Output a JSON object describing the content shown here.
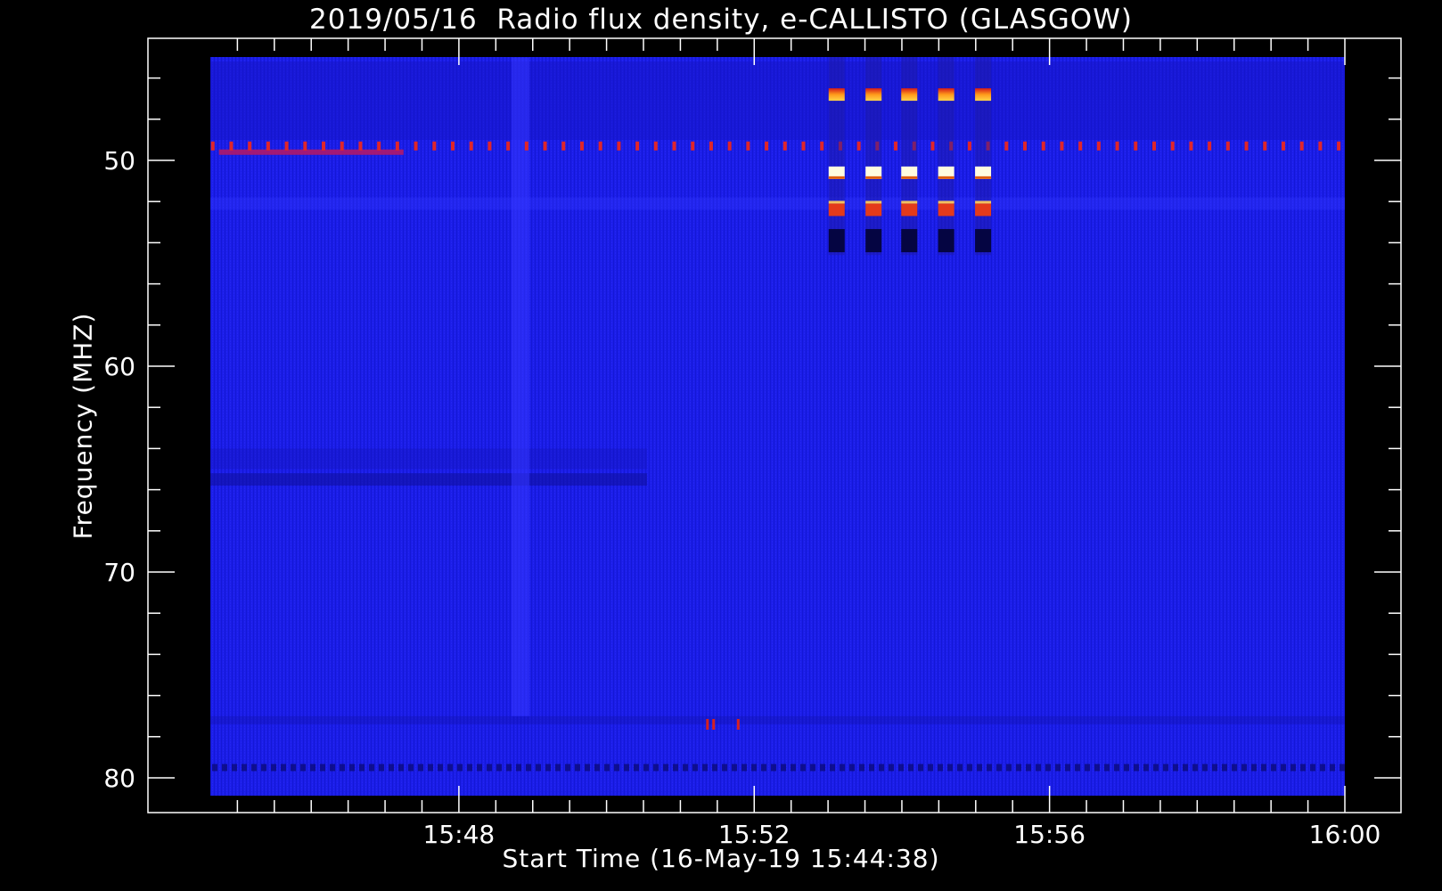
{
  "chart_data": {
    "type": "heatmap",
    "title": "2019/05/16  Radio flux density, e-CALLISTO (GLASGOW)",
    "xlabel": "Start Time (16-May-19 15:44:38)",
    "ylabel": "Frequency (MHZ)",
    "x_ticks": [
      "15:48",
      "15:52",
      "15:56",
      "16:00"
    ],
    "y_ticks": [
      50,
      60,
      70,
      80
    ],
    "xlim": [
      "15:44:38",
      "16:00:00"
    ],
    "ylim": [
      45,
      81
    ],
    "y_inverted": true,
    "colormap": "red-temperature on blue background",
    "colors": {
      "background": "#000000",
      "spectrogram_base": "#1b1de8"
    },
    "features": [
      {
        "name": "periodic red dots",
        "freq_mhz": 49.3,
        "time_start": "15:44:38",
        "time_end": "16:00:00",
        "period_s": 15
      },
      {
        "name": "red band",
        "freq_mhz": 49.6,
        "time_start": "15:44:45",
        "time_end": "15:47:15"
      },
      {
        "name": "broadband vertical stripe",
        "time": "15:48:50",
        "freq_range": [
          45,
          77
        ]
      },
      {
        "name": "calibration blocks",
        "times": [
          "15:53:07",
          "15:53:37",
          "15:54:06",
          "15:54:36",
          "15:55:06"
        ],
        "levels": [
          {
            "freq_mhz": 46.8,
            "color": "orange-yellow"
          },
          {
            "freq_mhz": 50.6,
            "color": "white"
          },
          {
            "freq_mhz": 52.4,
            "color": "red-orange"
          },
          {
            "freq_mhz": 53.9,
            "color": "dark navy"
          }
        ]
      },
      {
        "name": "small red marks",
        "freq_mhz": 77.4,
        "times": [
          "15:51:22",
          "15:51:27",
          "15:51:47"
        ]
      },
      {
        "name": "dark dashed band",
        "freq_mhz": 79.5,
        "time_start": "15:44:38",
        "time_end": "16:00:00"
      }
    ]
  }
}
